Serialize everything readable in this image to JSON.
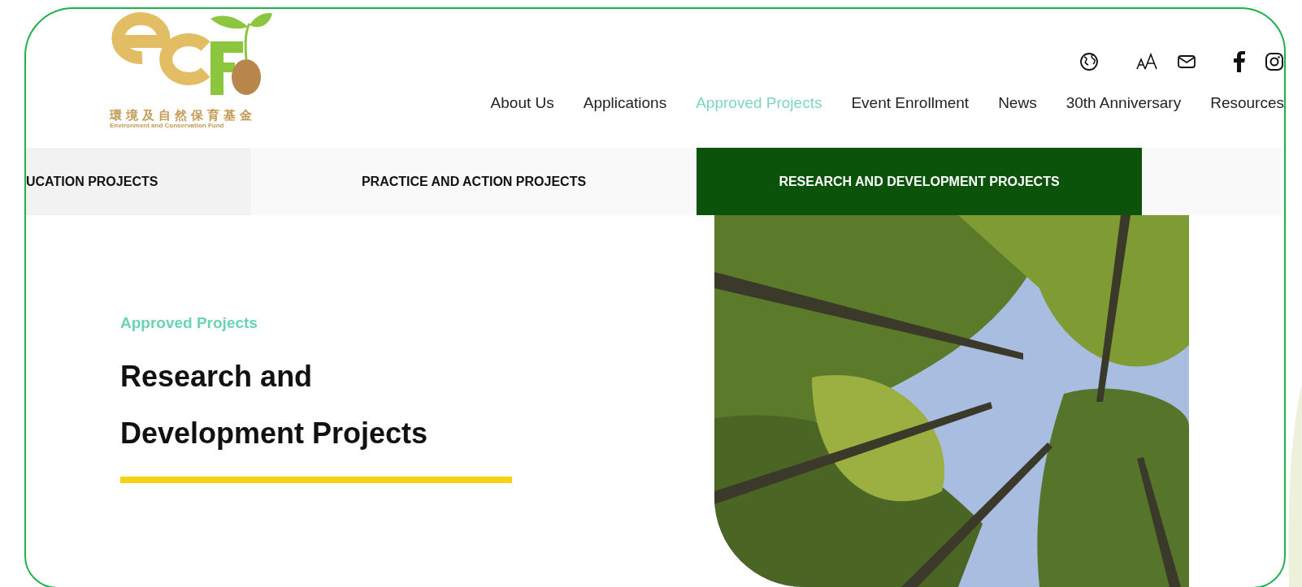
{
  "logo": {
    "chinese_name": "環境及自然保育基金",
    "english_name": "Environment and Conservation Fund"
  },
  "nav": [
    {
      "label": "About Us",
      "selected": false
    },
    {
      "label": "Applications",
      "selected": false
    },
    {
      "label": "Approved Projects",
      "selected": true
    },
    {
      "label": "Event Enrollment",
      "selected": false
    },
    {
      "label": "News",
      "selected": false
    },
    {
      "label": "30th Anniversary",
      "selected": false
    },
    {
      "label": "Resources",
      "selected": false
    }
  ],
  "tabs": [
    {
      "label": "UCATION PROJECTS",
      "selected": false
    },
    {
      "label": "PRACTICE AND ACTION PROJECTS",
      "selected": false
    },
    {
      "label": "RESEARCH AND DEVELOPMENT PROJECTS",
      "selected": true
    }
  ],
  "hero": {
    "eyebrow": "Approved Projects",
    "title": "Research and Development Projects"
  }
}
